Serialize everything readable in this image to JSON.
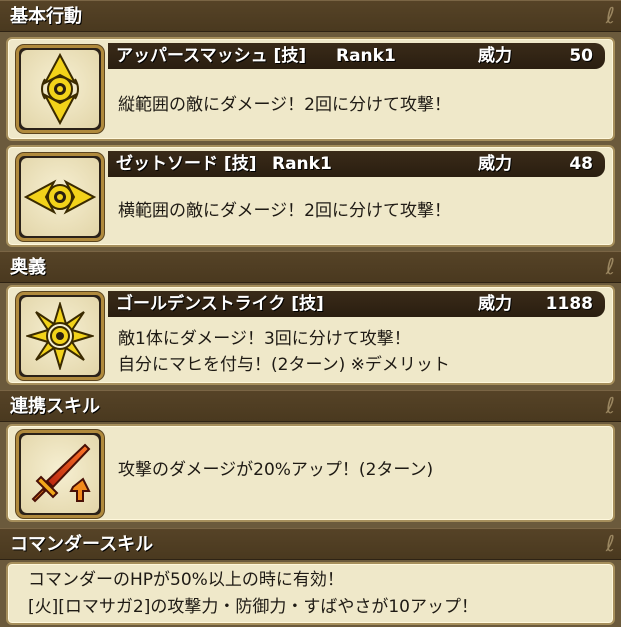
{
  "sections": {
    "basic": "基本行動",
    "secret": "奥義",
    "link": "連携スキル",
    "commander": "コマンダースキル"
  },
  "skills": {
    "upper": {
      "name": "アッパースマッシュ [技]",
      "rank": "Rank1",
      "power_label": "威力",
      "power": "50",
      "desc": "縦範囲の敵にダメージ！2回に分けて攻撃！",
      "icon": "vertical-range-icon"
    },
    "zet": {
      "name": "ゼットソード [技]",
      "rank": "Rank1",
      "power_label": "威力",
      "power": "48",
      "desc": "横範囲の敵にダメージ！2回に分けて攻撃！",
      "icon": "horizontal-range-icon"
    },
    "golden": {
      "name": "ゴールデンストライク [技]",
      "power_label": "威力",
      "power": "1188",
      "desc1": "敵1体にダメージ！3回に分けて攻撃！",
      "desc2": "自分にマヒを付与！(2ターン) ※デメリット",
      "icon": "single-target-burst-icon"
    }
  },
  "link_skill": {
    "desc": "攻撃のダメージが20%アップ！(2ターン)",
    "icon": "flame-sword-attack-up-icon"
  },
  "commander_skill": {
    "line1": "コマンダーのHPが50%以上の時に有効！",
    "line2": "[火][ロマサガ2]の攻撃力・防御力・すばやさが10アップ！"
  },
  "colors": {
    "header_bg": "#4f3d22",
    "card_bg": "#efe8c9",
    "titlebar_bg": "#2e2214",
    "icon_yellow": "#f2d21a"
  }
}
